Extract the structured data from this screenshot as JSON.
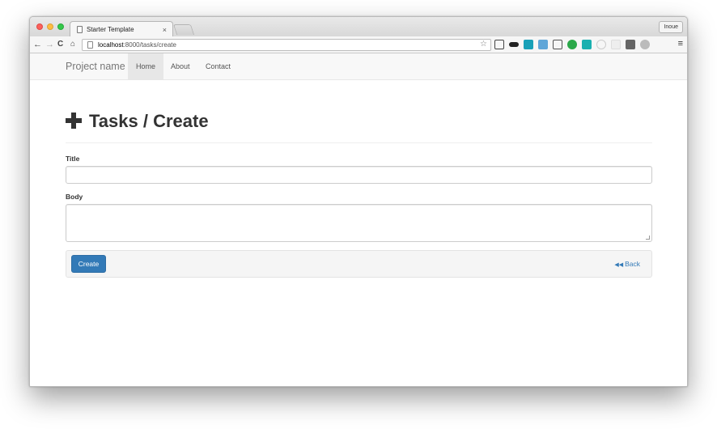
{
  "browser": {
    "tab_title": "Starter Template",
    "tab_close": "×",
    "profile": "Inoue",
    "url_host": "localhost",
    "url_path": ":8000/tasks/create"
  },
  "navbar": {
    "brand": "Project name",
    "links": [
      {
        "label": "Home",
        "active": true
      },
      {
        "label": "About",
        "active": false
      },
      {
        "label": "Contact",
        "active": false
      }
    ]
  },
  "form": {
    "heading": "Tasks / Create",
    "title_label": "Title",
    "title_value": "",
    "body_label": "Body",
    "body_value": "",
    "create_button": "Create",
    "back_link": "Back"
  },
  "colors": {
    "primary": "#337ab7",
    "navbar_bg": "#f8f8f8",
    "well_bg": "#f5f5f5"
  }
}
